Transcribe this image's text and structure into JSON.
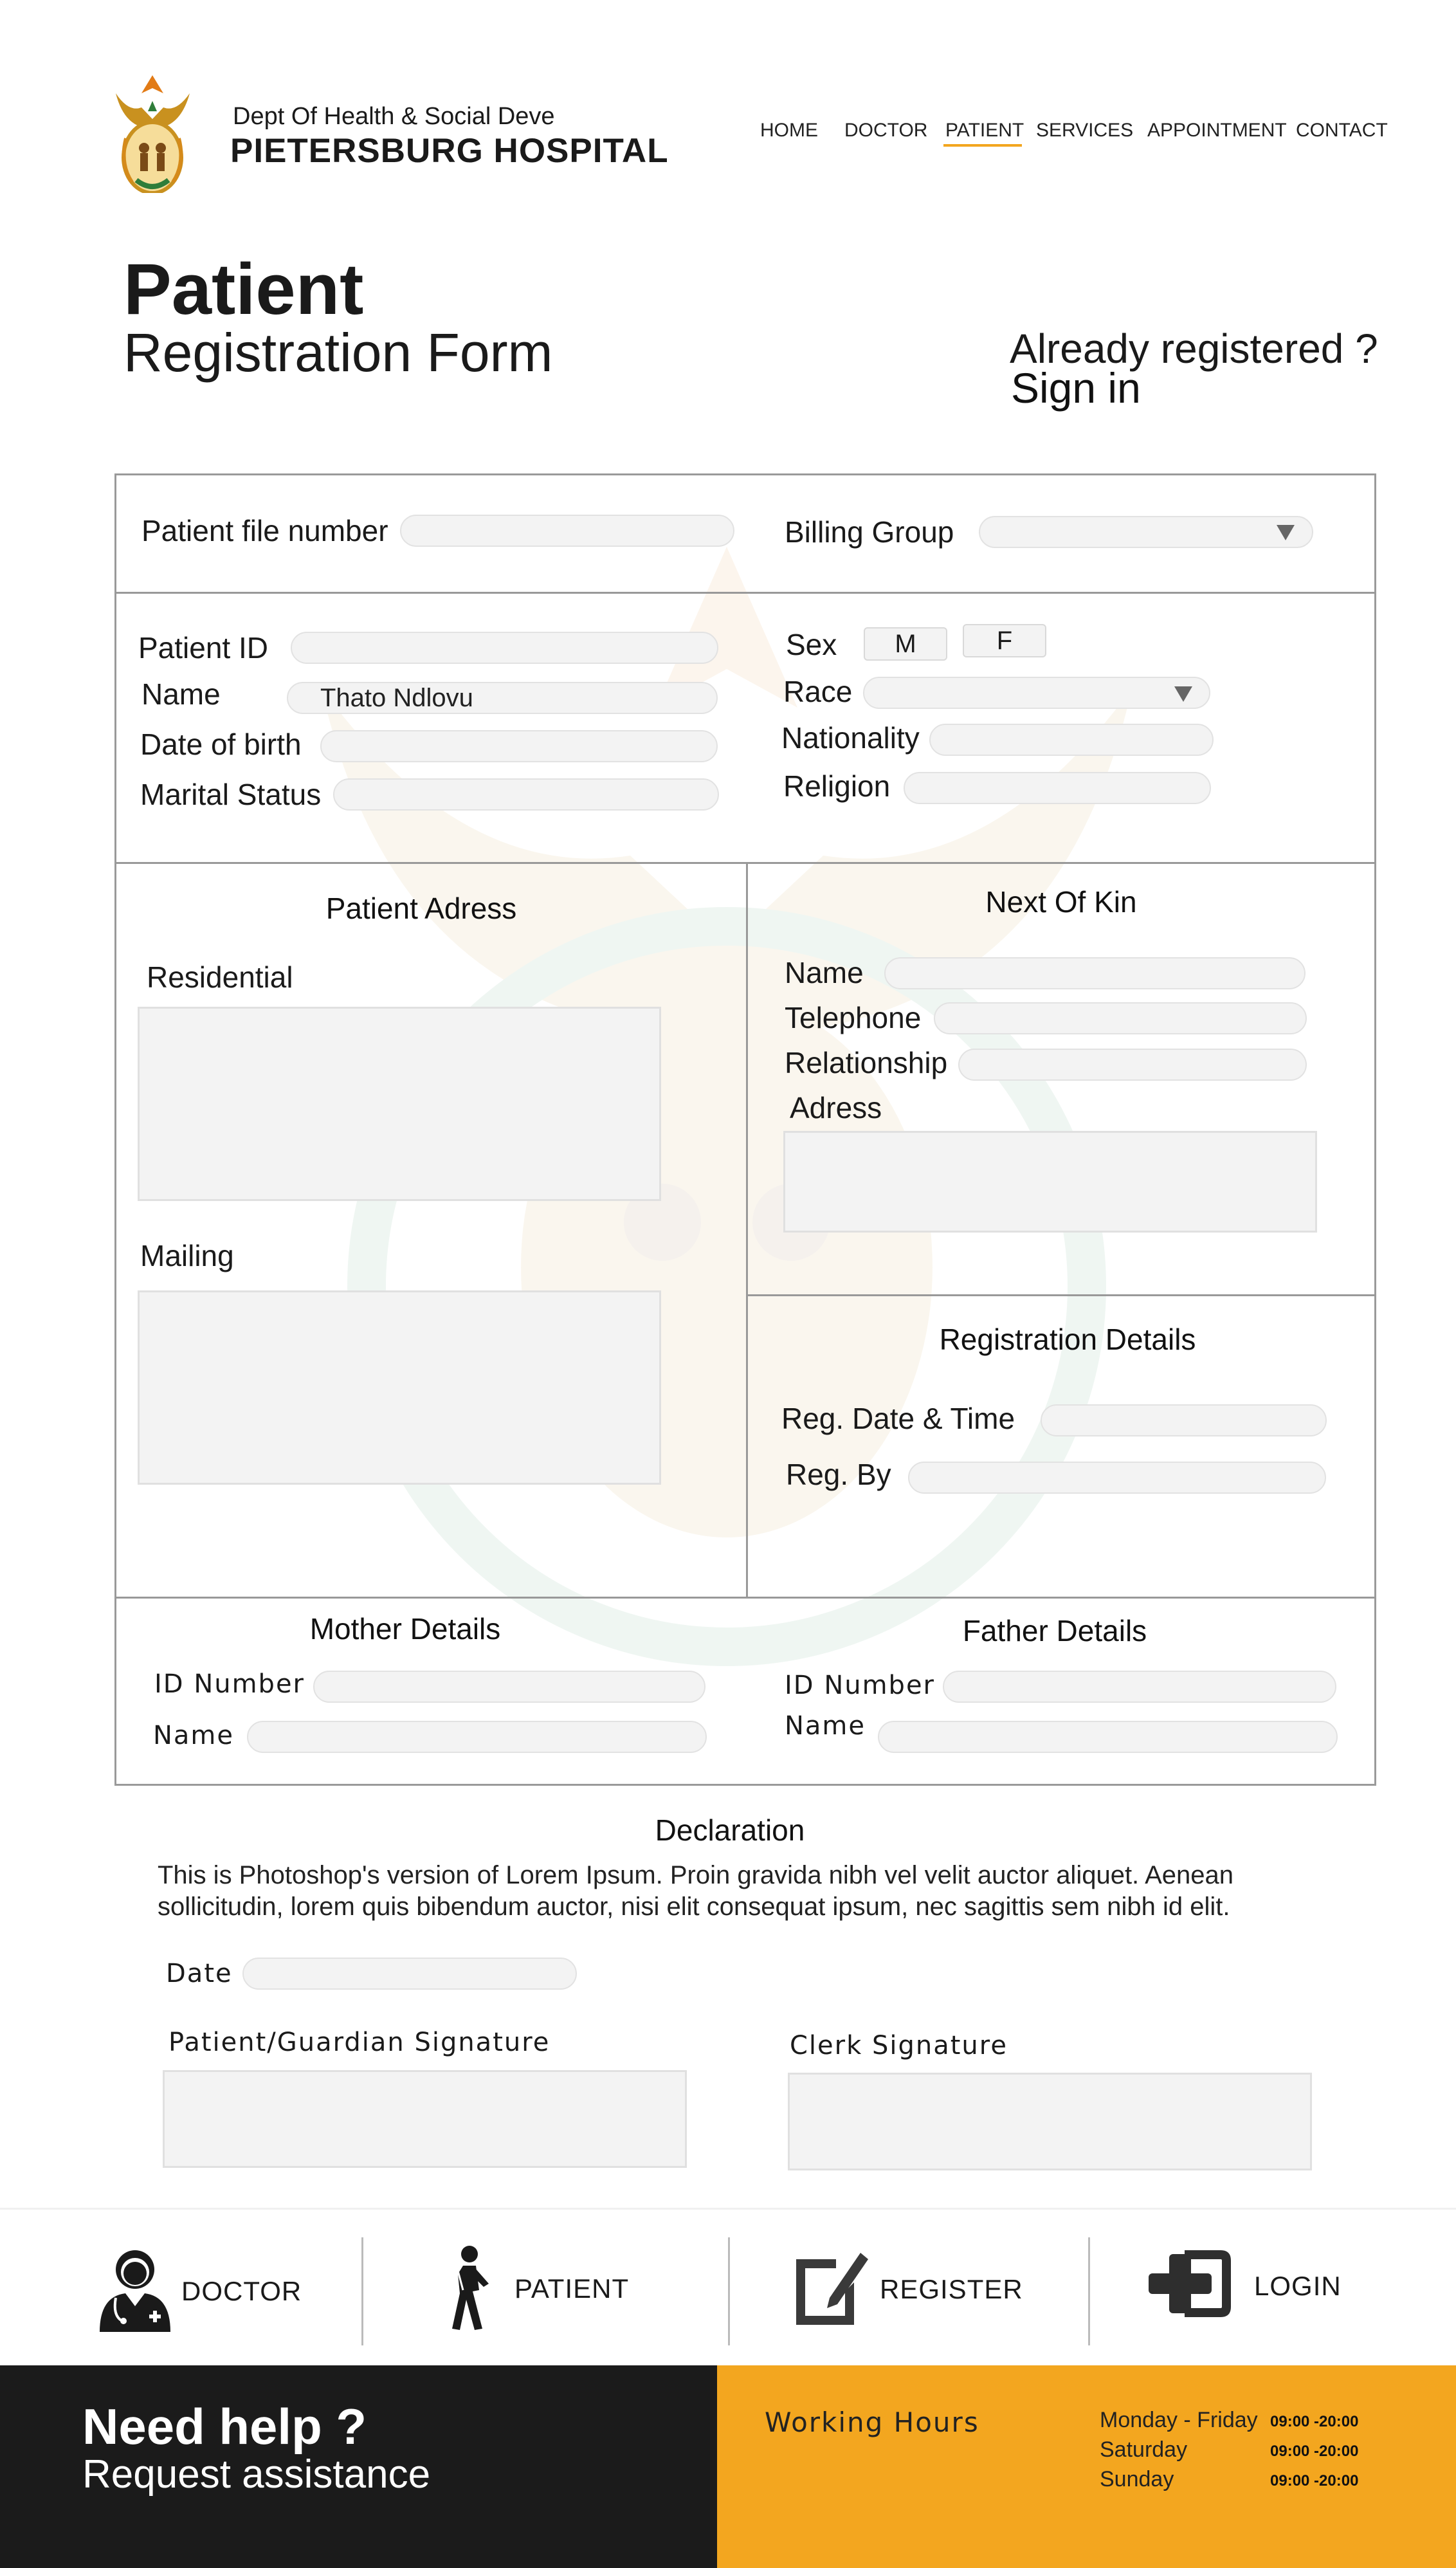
{
  "header": {
    "dept": "Dept Of Health & Social Deve",
    "hospital": "PIETERSBURG HOSPITAL",
    "logo_icon": "coat-of-arms-icon",
    "nav": [
      "HOME",
      "DOCTOR",
      "PATIENT",
      "SERVICES",
      "APPOINTMENT",
      "CONTACT"
    ],
    "active_nav": "PATIENT",
    "accent_color": "#f3a61f"
  },
  "title": {
    "main": "Patient",
    "sub": "Registration Form",
    "already": "Already registered ?",
    "signin": "Sign in"
  },
  "top": {
    "file_number_label": "Patient file number",
    "file_number_value": "",
    "billing_label": "Billing Group",
    "billing_value": ""
  },
  "personal": {
    "patient_id_label": "Patient ID",
    "patient_id_value": "",
    "name_label": "Name",
    "name_value": "Thato Ndlovu",
    "dob_label": "Date of birth",
    "dob_value": "",
    "marital_label": "Marital Status",
    "marital_value": "",
    "sex_label": "Sex",
    "sex_m": "M",
    "sex_f": "F",
    "race_label": "Race",
    "race_value": "",
    "nationality_label": "Nationality",
    "nationality_value": "",
    "religion_label": "Religion",
    "religion_value": ""
  },
  "address": {
    "title": "Patient Adress",
    "residential_label": "Residential",
    "residential_value": "",
    "mailing_label": "Mailing",
    "mailing_value": ""
  },
  "kin": {
    "title": "Next Of Kin",
    "name_label": "Name",
    "name_value": "",
    "telephone_label": "Telephone",
    "telephone_value": "",
    "relationship_label": "Relationship",
    "relationship_value": "",
    "address_label": "Adress",
    "address_value": ""
  },
  "registration": {
    "title": "Registration Details",
    "date_label": "Reg. Date & Time",
    "date_value": "",
    "by_label": "Reg. By",
    "by_value": ""
  },
  "mother": {
    "title": "Mother Details",
    "id_label": "ID Number",
    "id_value": "",
    "name_label": "Name",
    "name_value": ""
  },
  "father": {
    "title": "Father Details",
    "id_label": "ID Number",
    "id_value": "",
    "name_label": "Name",
    "name_value": ""
  },
  "declaration": {
    "title": "Declaration",
    "line1": "This is Photoshop's version  of Lorem Ipsum. Proin gravida nibh vel velit auctor aliquet. Aenean",
    "line2": "sollicitudin, lorem quis bibendum auctor, nisi elit consequat ipsum, nec sagittis sem nibh id elit.",
    "date_label": "Date",
    "date_value": "",
    "patient_sig_label": "Patient/Guardian Signature",
    "clerk_sig_label": "Clerk Signature"
  },
  "quicklinks": [
    {
      "label": "DOCTOR",
      "icon": "doctor-icon"
    },
    {
      "label": "PATIENT",
      "icon": "walking-patient-icon"
    },
    {
      "label": "REGISTER",
      "icon": "edit-form-icon"
    },
    {
      "label": "LOGIN",
      "icon": "medical-cross-login-icon"
    }
  ],
  "footer": {
    "help": "Need help ?",
    "assist": "Request assistance",
    "hours_title": "Working Hours",
    "hours": [
      {
        "day": "Monday - Friday",
        "time": "09:00 -20:00"
      },
      {
        "day": "Saturday",
        "time": "09:00 -20:00"
      },
      {
        "day": "Sunday",
        "time": "09:00 -20:00"
      }
    ],
    "dark_color": "#1b1b1b",
    "accent_color": "#f3a61f"
  }
}
